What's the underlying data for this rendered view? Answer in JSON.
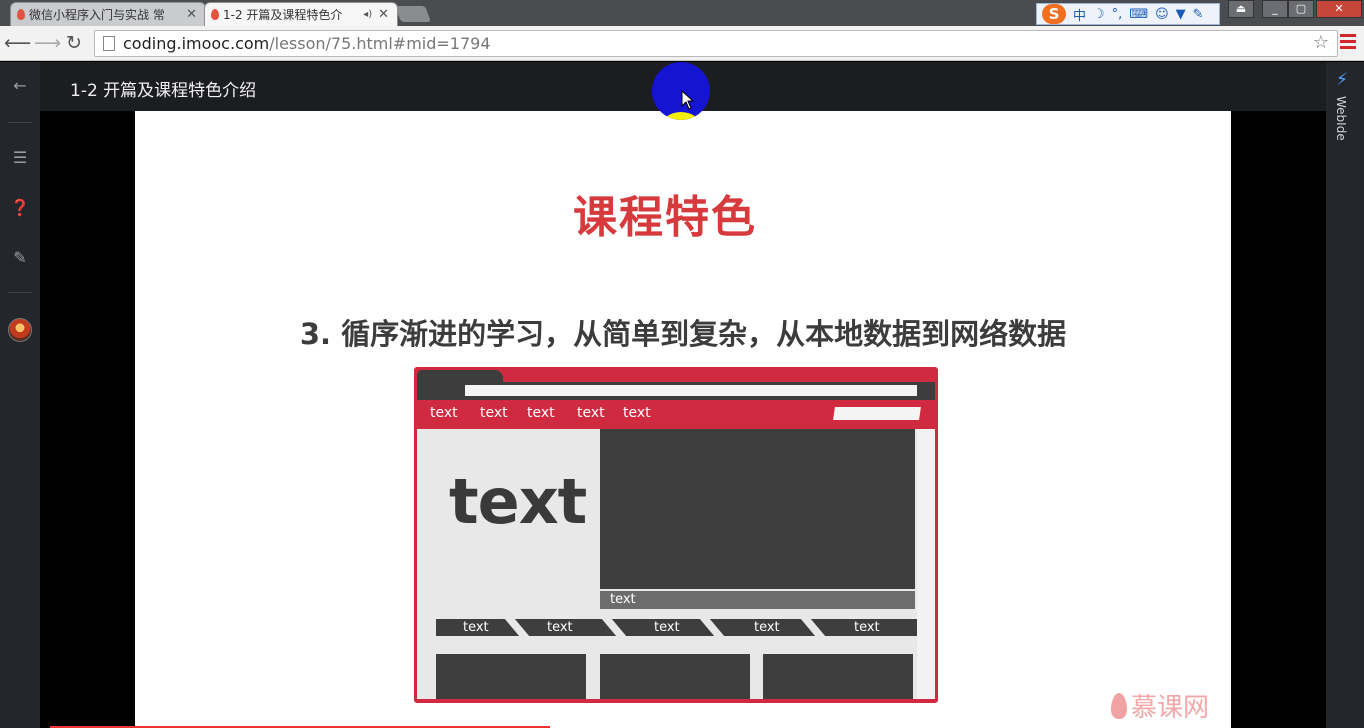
{
  "browser": {
    "tabs": [
      {
        "title": "微信小程序入门与实战 常",
        "active": false
      },
      {
        "title": "1-2 开篇及课程特色介",
        "active": true
      }
    ],
    "url_host": "coding.imooc.com",
    "url_path": "/lesson/75.html#mid=1794",
    "ime": {
      "logo": "S",
      "mode": "中"
    }
  },
  "page": {
    "lesson_title": "1-2 开篇及课程特色介绍",
    "right_panel_label": "WebIde"
  },
  "slide": {
    "title": "课程特色",
    "subtitle": "3. 循序渐进的学习，从简单到复杂，从本地数据到网络数据",
    "illustration": {
      "nav_items": [
        "text",
        "text",
        "text",
        "text",
        "text"
      ],
      "big_text": "text",
      "video_bar_label": "text",
      "row_items": [
        "text",
        "text",
        "text",
        "text",
        "text"
      ]
    },
    "logo_text": "慕课网"
  },
  "colors": {
    "accent_red": "#d63a3c",
    "dark_chrome": "#1b1d20"
  }
}
